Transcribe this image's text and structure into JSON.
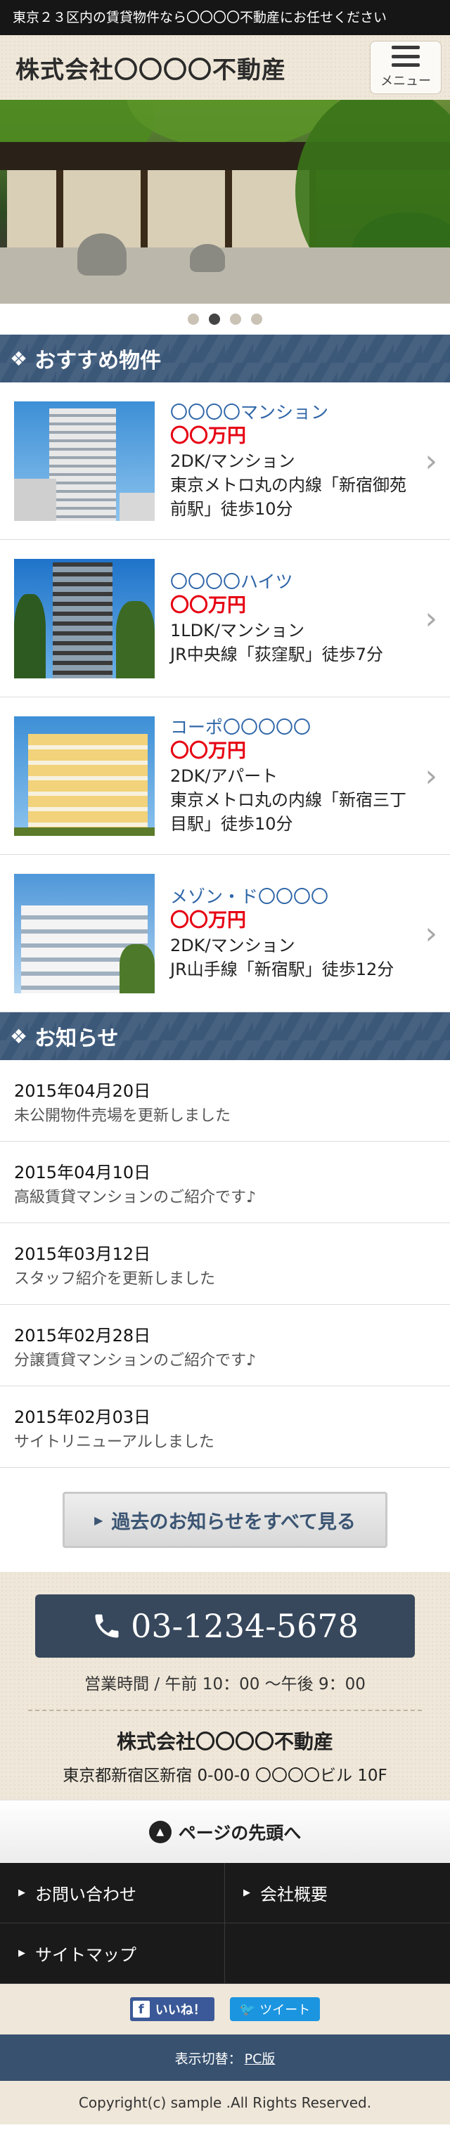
{
  "topbar": {
    "text": "東京２３区内の賃貸物件なら〇〇〇〇不動産にお任せください"
  },
  "header": {
    "site_title": "株式会社〇〇〇〇不動産",
    "menu_label": "メニュー"
  },
  "slider": {
    "dot_count": 4,
    "active_index": 1
  },
  "featured": {
    "heading": "おすすめ物件",
    "items": [
      {
        "name": "〇〇〇〇マンション",
        "price": "〇〇万円",
        "desc1": "2DK/マンション",
        "desc2": "東京メトロ丸の内線「新宿御苑前駅」徒歩10分"
      },
      {
        "name": "〇〇〇〇ハイツ",
        "price": "〇〇万円",
        "desc1": "1LDK/マンション",
        "desc2": "JR中央線「荻窪駅」徒歩7分"
      },
      {
        "name": "コーポ〇〇〇〇〇",
        "price": "〇〇万円",
        "desc1": "2DK/アパート",
        "desc2": "東京メトロ丸の内線「新宿三丁目駅」徒歩10分"
      },
      {
        "name": "メゾン・ド〇〇〇〇",
        "price": "〇〇万円",
        "desc1": "2DK/マンション",
        "desc2": "JR山手線「新宿駅」徒歩12分"
      }
    ]
  },
  "news": {
    "heading": "お知らせ",
    "items": [
      {
        "date": "2015年04月20日",
        "text": "未公開物件売場を更新しました"
      },
      {
        "date": "2015年04月10日",
        "text": "高級賃貸マンションのご紹介です♪"
      },
      {
        "date": "2015年03月12日",
        "text": "スタッフ紹介を更新しました"
      },
      {
        "date": "2015年02月28日",
        "text": "分譲賃貸マンションのご紹介です♪"
      },
      {
        "date": "2015年02月03日",
        "text": "サイトリニューアルしました"
      }
    ],
    "more_label": "過去のお知らせをすべて見る"
  },
  "contact": {
    "tel": "03-1234-5678",
    "hours": "営業時間 / 午前 10：00 〜午後 9：00",
    "company": "株式会社〇〇〇〇不動産",
    "address": "東京都新宿区新宿 0-00-0 〇〇〇〇ビル 10F"
  },
  "pagetop": {
    "label": "ページの先頭へ"
  },
  "footer_nav": [
    "お問い合わせ",
    "会社概要",
    "サイトマップ",
    ""
  ],
  "social": {
    "like_label": "いいね！",
    "tweet_label": "ツイート"
  },
  "switch": {
    "label": "表示切替：",
    "pc_link": "PC版"
  },
  "copyright": "Copyright(c) sample .All Rights Reserved."
}
